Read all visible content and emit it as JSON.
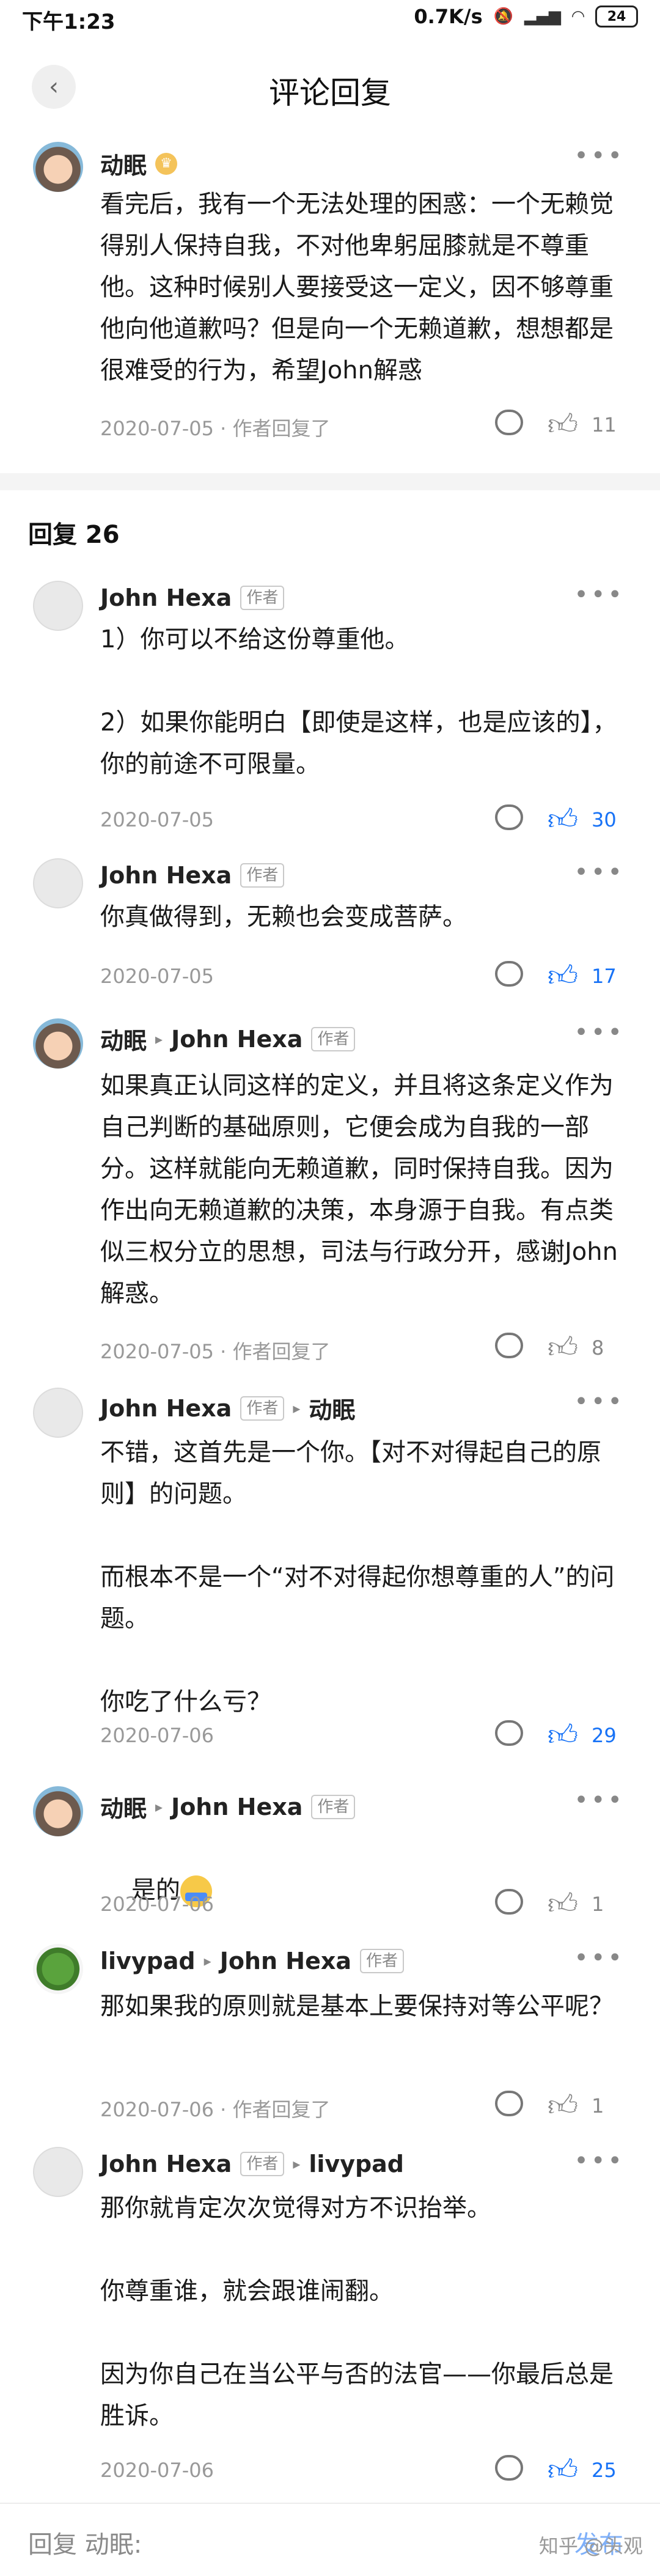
{
  "status_bar": {
    "time": "下午1:23",
    "speed": "0.7K/s",
    "battery": "24"
  },
  "header": {
    "title": "评论回复"
  },
  "main_comment": {
    "author": "动眠",
    "text": "看完后，我有一个无法处理的困惑：一个无赖觉得别人保持自我，不对他卑躬屈膝就是不尊重他。这种时候别人要接受这一定义，因不够尊重他向他道歉吗？但是向一个无赖道歉，想想都是很难受的行为，希望John解惑",
    "date": "2020-07-05 · 作者回复了",
    "likes": "11"
  },
  "replies_header": "回复 26",
  "replies": [
    {
      "author": "John Hexa",
      "tag": "作者",
      "reply_to": "",
      "reply_to_tag": "",
      "text": "1）你可以不给这份尊重他。\n\n2）如果你能明白【即使是这样，也是应该的】，你的前途不可限量。",
      "date": "2020-07-05",
      "likes": "30",
      "liked": true
    },
    {
      "author": "John Hexa",
      "tag": "作者",
      "reply_to": "",
      "reply_to_tag": "",
      "text": "你真做得到，无赖也会变成菩萨。",
      "date": "2020-07-05",
      "likes": "17",
      "liked": true
    },
    {
      "author": "动眠",
      "tag": "",
      "reply_to": "John Hexa",
      "reply_to_tag": "作者",
      "text": "如果真正认同这样的定义，并且将这条定义作为自己判断的基础原则，它便会成为自我的一部分。这样就能向无赖道歉，同时保持自我。因为作出向无赖道歉的决策，本身源于自我。有点类似三权分立的思想，司法与行政分开，感谢John解惑。",
      "date": "2020-07-05 · 作者回复了",
      "likes": "8",
      "liked": false
    },
    {
      "author": "John Hexa",
      "tag": "作者",
      "reply_to": "动眠",
      "reply_to_tag": "",
      "text": "不错，这首先是一个你。【对不对得起自己的原则】的问题。\n\n而根本不是一个“对不对得起你想尊重的人”的问题。\n\n你吃了什么亏？",
      "date": "2020-07-06",
      "likes": "29",
      "liked": true
    },
    {
      "author": "动眠",
      "tag": "",
      "reply_to": "John Hexa",
      "reply_to_tag": "作者",
      "text": "是的",
      "date": "2020-07-06",
      "likes": "1",
      "liked": false
    },
    {
      "author": "livypad",
      "tag": "",
      "reply_to": "John Hexa",
      "reply_to_tag": "作者",
      "text": "那如果我的原则就是基本上要保持对等公平呢？",
      "date": "2020-07-06 · 作者回复了",
      "likes": "1",
      "liked": false
    },
    {
      "author": "John Hexa",
      "tag": "作者",
      "reply_to": "livypad",
      "reply_to_tag": "",
      "text": "那你就肯定次次觉得对方不识抬举。\n\n你尊重谁，就会跟谁闹翻。\n\n因为你自己在当公平与否的法官——你最后总是胜诉。",
      "date": "2020-07-06",
      "likes": "25",
      "liked": true
    }
  ],
  "bottom_bar": {
    "reply_placeholder": "回复 动眠:",
    "send_label": "发布"
  },
  "watermark": "知乎 @头观",
  "colors": {
    "accent": "#1772f6",
    "muted": "#999999"
  }
}
